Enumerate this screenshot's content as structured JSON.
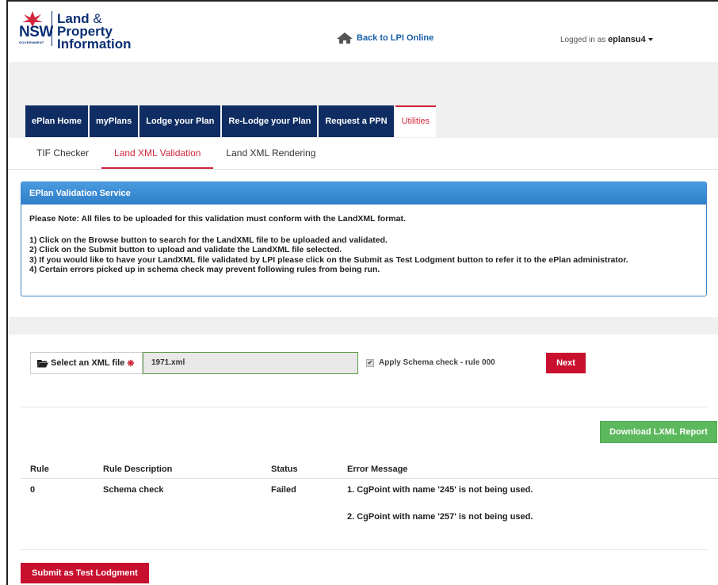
{
  "header": {
    "logo_nsw": "NSW",
    "logo_gov": "GOVERNMENT",
    "logo_line1": "Land",
    "logo_amp": " & ",
    "logo_line1b": "Property",
    "logo_line2": "Information",
    "back_link": "Back to LPI Online",
    "logged_in_label": "Logged in as",
    "username": "eplansu4"
  },
  "nav": {
    "items": [
      {
        "label": "ePlan Home"
      },
      {
        "label": "myPlans"
      },
      {
        "label": "Lodge your Plan"
      },
      {
        "label": "Re-Lodge your Plan"
      },
      {
        "label": "Request a PPN"
      },
      {
        "label": "Utilities"
      }
    ],
    "active_index": 5
  },
  "subtabs": {
    "items": [
      {
        "label": "TIF Checker"
      },
      {
        "label": "Land XML Validation"
      },
      {
        "label": "Land XML Rendering"
      }
    ],
    "active_index": 1
  },
  "panel": {
    "title": "EPlan Validation Service",
    "note": "Please Note: All files to be uploaded for this validation must conform with the LandXML format.",
    "steps": [
      "1) Click on the Browse button to search for the LandXML file to be uploaded and validated.",
      "2) Click on the Submit button to upload and validate the LandXML file selected.",
      "3) If you would like to have your LandXML file validated by LPI please click on the Submit as Test Lodgment button to refer it to the ePlan administrator.",
      "4) Certain errors picked up in schema check may prevent following rules from being run."
    ]
  },
  "upload": {
    "select_label": "Select an XML file",
    "required_mark": "❋",
    "file_value": "1971.xml",
    "schema_check_label": "Apply Schema check - rule 000",
    "schema_checked": true,
    "next_label": "Next"
  },
  "download_label": "Download LXML Report",
  "results": {
    "headers": [
      "Rule",
      "Rule Description",
      "Status",
      "Error Message"
    ],
    "rows": [
      {
        "rule": "0",
        "description": "Schema check",
        "status": "Failed",
        "errors": [
          "1. CgPoint with name '245' is not being used.",
          "2. CgPoint with name '257' is not being used."
        ]
      }
    ]
  },
  "submit_label": "Submit as Test Lodgment",
  "colors": {
    "navy": "#0f2d62",
    "accent_red": "#c8102e",
    "panel_blue": "#2f7fc8",
    "download_green": "#5cb85c"
  }
}
